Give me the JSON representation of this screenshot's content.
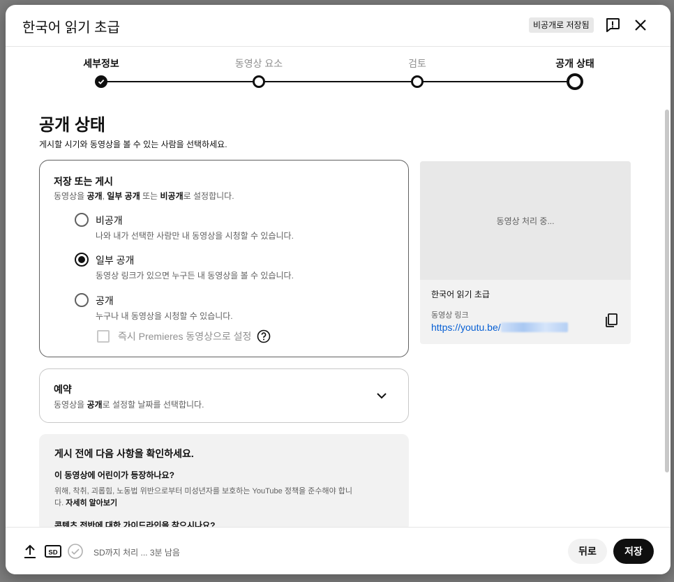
{
  "header": {
    "title": "한국어 읽기 초급",
    "saved_badge": "비공개로 저장됨"
  },
  "stepper": {
    "steps": [
      {
        "label": "세부정보",
        "state": "done"
      },
      {
        "label": "동영상 요소",
        "state": "pending"
      },
      {
        "label": "검토",
        "state": "pending"
      },
      {
        "label": "공개 상태",
        "state": "current"
      }
    ]
  },
  "page": {
    "title": "공개 상태",
    "subtitle": "게시할 시기와 동영상을 볼 수 있는 사람을 선택하세요."
  },
  "save_or_publish": {
    "title": "저장 또는 게시",
    "sub_1": "동영상을 ",
    "sub_b1": "공개",
    "sub_2": ", ",
    "sub_b2": "일부 공개",
    "sub_3": " 또는 ",
    "sub_b3": "비공개",
    "sub_4": "로 설정합니다.",
    "options": [
      {
        "label": "비공개",
        "desc": "나와 내가 선택한 사람만 내 동영상을 시청할 수 있습니다.",
        "selected": false
      },
      {
        "label": "일부 공개",
        "desc": "동영상 링크가 있으면 누구든 내 동영상을 볼 수 있습니다.",
        "selected": true
      },
      {
        "label": "공개",
        "desc": "누구나 내 동영상을 시청할 수 있습니다.",
        "selected": false
      }
    ],
    "premiere_label": "즉시 Premieres 동영상으로 설정"
  },
  "schedule": {
    "title": "예약",
    "sub_1": "동영상을 ",
    "sub_b": "공개",
    "sub_2": "로 설정할 날짜를 선택합니다."
  },
  "notice": {
    "title": "게시 전에 다음 사항을 확인하세요.",
    "q1": "이 동영상에 어린이가 등장하나요?",
    "body_1": "위해, 착취, 괴롭힘, 노동법 위반으로부터 미성년자를 보호하는 YouTube 정책을 준수해야 합니다. ",
    "body_link": "자세히 알아보기",
    "q2": "콘텐츠 전반에 대한 가이드라인을 찾으시나요?"
  },
  "preview": {
    "processing": "동영상 처리 중...",
    "video_title": "한국어 읽기 초급",
    "link_label": "동영상 링크",
    "link_prefix": "https://youtu.be/"
  },
  "footer": {
    "status": "SD까지 처리 ... 3분 남음",
    "sd_label": "SD",
    "back_label": "뒤로",
    "save_label": "저장"
  }
}
